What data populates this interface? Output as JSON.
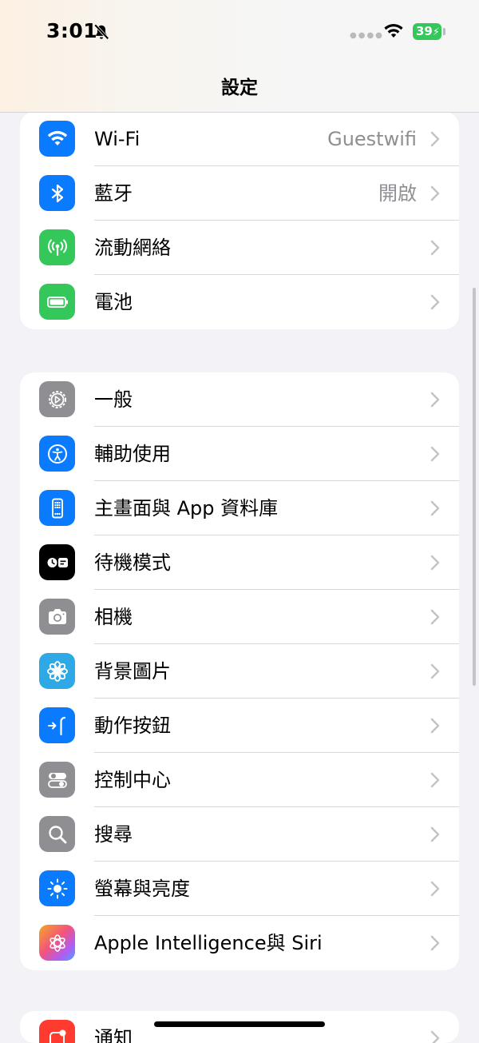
{
  "status_bar": {
    "time": "3:01",
    "battery": "39"
  },
  "nav": {
    "title": "設定"
  },
  "group1": [
    {
      "label": "Wi-Fi",
      "value": "Guestwifi",
      "icon": "wifi-icon",
      "color": "#0a7aff"
    },
    {
      "label": "藍牙",
      "value": "開啟",
      "icon": "bluetooth-icon",
      "color": "#0a7aff"
    },
    {
      "label": "流動網絡",
      "value": "",
      "icon": "antenna-icon",
      "color": "#34c759"
    },
    {
      "label": "電池",
      "value": "",
      "icon": "battery-icon",
      "color": "#34c759"
    }
  ],
  "group2": [
    {
      "label": "一般",
      "icon": "gear-icon",
      "color": "#8e8e93"
    },
    {
      "label": "輔助使用",
      "icon": "accessibility-icon",
      "color": "#0a7aff"
    },
    {
      "label": "主畫面與 App 資料庫",
      "icon": "home-screen-icon",
      "color": "#0a7aff"
    },
    {
      "label": "待機模式",
      "icon": "standby-icon",
      "color": "#000000"
    },
    {
      "label": "相機",
      "icon": "camera-icon",
      "color": "#8e8e93"
    },
    {
      "label": "背景圖片",
      "icon": "flower-icon",
      "color": "#2fa9e6"
    },
    {
      "label": "動作按鈕",
      "icon": "action-button-icon",
      "color": "#0a7aff"
    },
    {
      "label": "控制中心",
      "icon": "control-center-icon",
      "color": "#8e8e93"
    },
    {
      "label": "搜尋",
      "icon": "search-icon",
      "color": "#8e8e93"
    },
    {
      "label": "螢幕與亮度",
      "icon": "sun-icon",
      "color": "#0a7aff"
    },
    {
      "label": "Apple Intelligence與 Siri",
      "icon": "apple-intelligence-icon",
      "color": "#e85a9a"
    }
  ],
  "group3": [
    {
      "label": "通知",
      "icon": "notification-icon",
      "color": "#ff3b30"
    }
  ]
}
